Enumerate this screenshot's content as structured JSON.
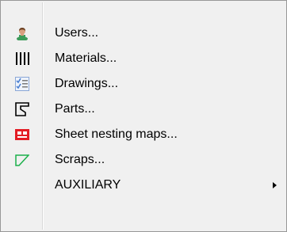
{
  "menu": {
    "items": [
      {
        "label": "Users...",
        "icon": "user-icon"
      },
      {
        "label": "Materials...",
        "icon": "materials-icon"
      },
      {
        "label": "Drawings...",
        "icon": "drawings-icon"
      },
      {
        "label": "Parts...",
        "icon": "parts-icon"
      },
      {
        "label": "Sheet nesting maps...",
        "icon": "sheet-nesting-maps-icon"
      },
      {
        "label": "Scraps...",
        "icon": "scraps-icon"
      },
      {
        "label": "AUXILIARY",
        "icon": "",
        "submenu": true
      }
    ]
  },
  "colors": {
    "menu_background": "#f0f0f0",
    "menu_border": "#979797",
    "sheet_icon_red": "#e31c24",
    "scraps_icon_green": "#1bb04a",
    "drawings_icon_blue": "#4a7fd1",
    "user_icon_green": "#3d9b5a"
  }
}
